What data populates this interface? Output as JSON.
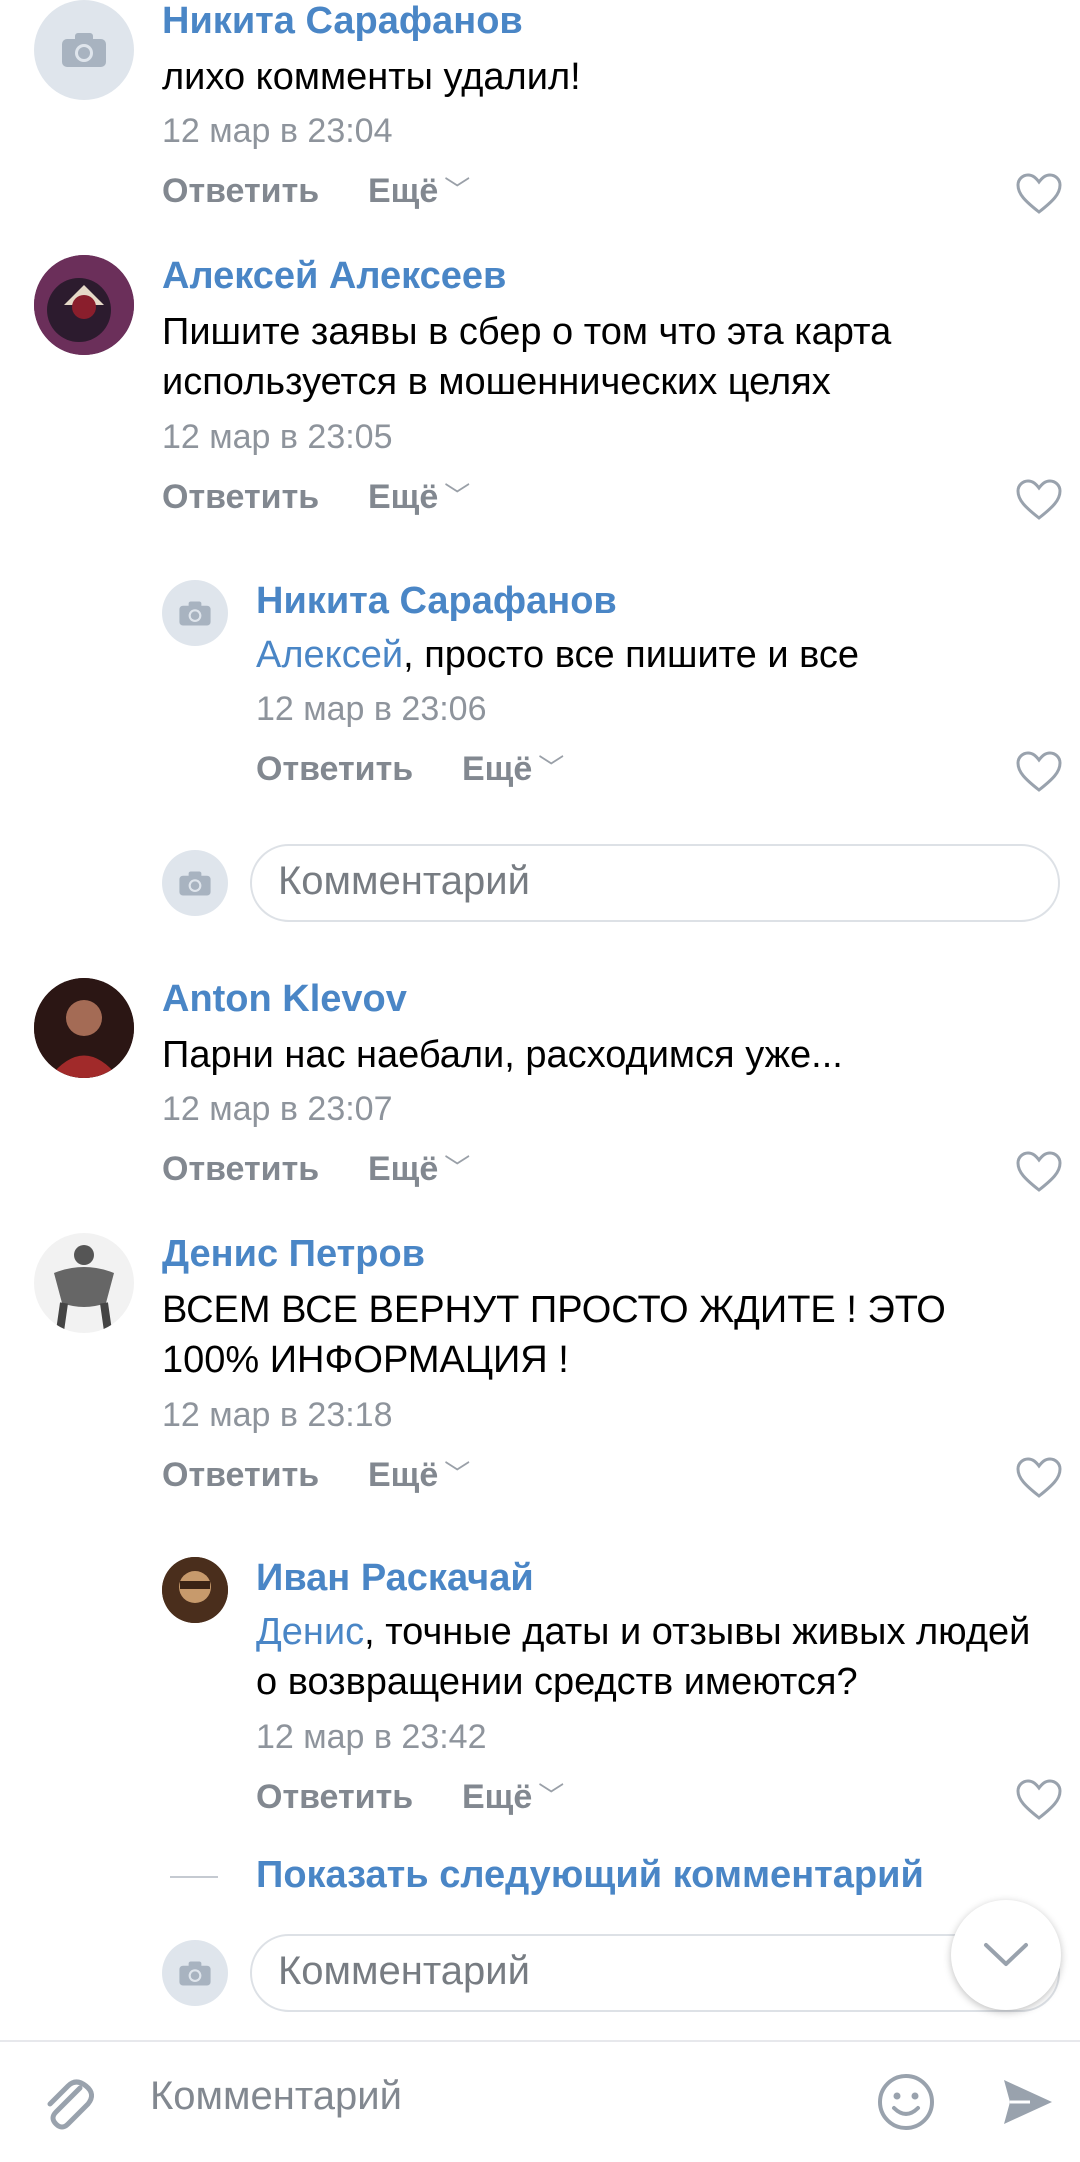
{
  "comments": [
    {
      "name": "Никита Сарафанов",
      "text": "лихо комменты удалил!",
      "date": "12 мар в 23:04"
    },
    {
      "name": "Алексей Алексеев",
      "text": "Пишите заявы в сбер о том что эта карта используется в мошеннических целях",
      "date": "12 мар в 23:05"
    },
    {
      "name": "Никита Сарафанов",
      "mention": "Алексей",
      "text": ", просто все пишите и все",
      "date": "12 мар в 23:06"
    },
    {
      "name": "Anton Klevov",
      "text": "Парни нас наебали, расходимся уже...",
      "date": "12 мар в 23:07"
    },
    {
      "name": "Денис Петров",
      "text": "ВСЕМ ВСЕ ВЕРНУТ ПРОСТО ЖДИТЕ ! ЭТО 100% ИНФОРМАЦИЯ !",
      "date": "12 мар в 23:18"
    },
    {
      "name": "Иван Раскачай",
      "mention": "Денис",
      "text": ", точные даты и отзывы живых людей о возвращении средств имеются?",
      "date": "12 мар в 23:42"
    }
  ],
  "actions": {
    "reply": "Ответить",
    "more": "Ещё"
  },
  "thread_comment_placeholder": "Комментарий",
  "show_next": "Показать следующий комментарий",
  "bottom_bar": {
    "placeholder": "Комментарий"
  },
  "icons": {
    "camera": "camera-icon",
    "heart": "heart-icon",
    "attach": "paperclip-icon",
    "emoji": "emoji-icon",
    "send": "send-icon",
    "scroll": "chevron-down-icon"
  },
  "colors": {
    "link": "#4a86c6",
    "date": "#8e949c",
    "action": "#828890",
    "placeholder_bg": "#dfe5ec"
  }
}
